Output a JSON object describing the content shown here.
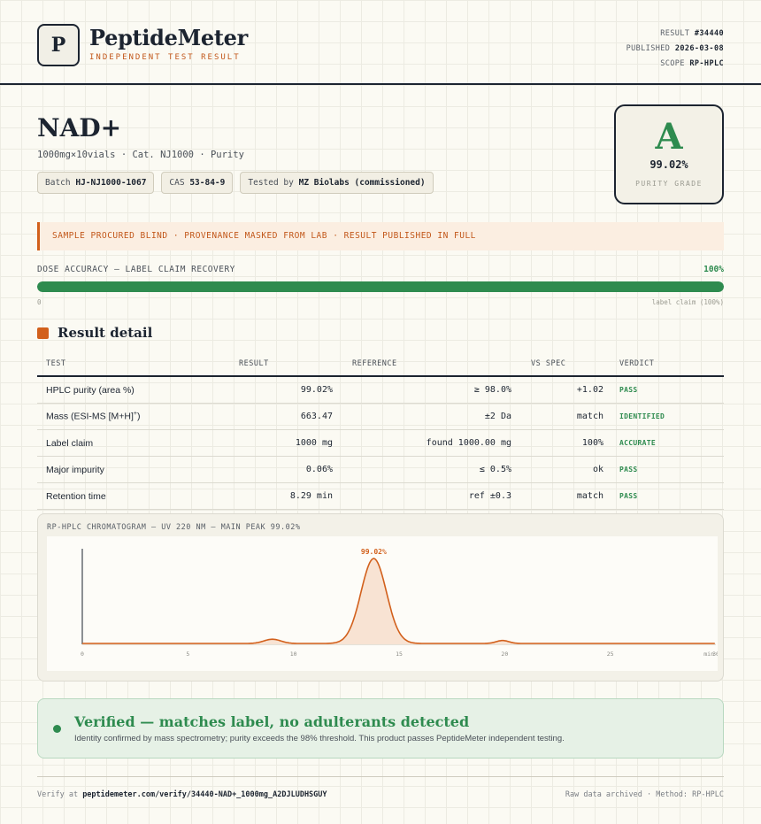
{
  "brand": {
    "logo_letter": "P",
    "name": "PeptideMeter",
    "subtitle": "INDEPENDENT TEST RESULT"
  },
  "meta": {
    "result_label": "RESULT",
    "result_value": "#34440",
    "published_label": "PUBLISHED",
    "published_value": "2026-03-08",
    "scope_label": "SCOPE",
    "scope_value": "RP-HPLC"
  },
  "product": {
    "name": "NAD+",
    "line": "1000mg×10vials · Cat. NJ1000 · Purity",
    "tags": [
      {
        "label": "Batch",
        "value": "HJ-NJ1000-1067"
      },
      {
        "label": "CAS",
        "value": "53-84-9"
      },
      {
        "label": "Tested by",
        "value": "MZ Biolabs (commissioned)"
      }
    ]
  },
  "grade": {
    "letter": "A",
    "value": "99.02%",
    "label": "PURITY GRADE"
  },
  "banner": "SAMPLE PROCURED BLIND · PROVENANCE MASKED FROM LAB · RESULT PUBLISHED IN FULL",
  "dose": {
    "label": "DOSE ACCURACY — LABEL CLAIM RECOVERY",
    "percent_text": "100%",
    "fill_percent": 100,
    "zero": "0",
    "claim": "label claim (100%)"
  },
  "section_title": "Result detail",
  "table": {
    "headers": [
      "TEST",
      "RESULT",
      "REFERENCE",
      "VS SPEC",
      "VERDICT"
    ],
    "rows": [
      {
        "test": "HPLC purity (area %)",
        "sup": "",
        "result": "99.02%",
        "reference": "≥ 98.0%",
        "vs": "+1.02",
        "verdict": "PASS"
      },
      {
        "test": "Mass (ESI-MS [M+H]",
        "sup": "+",
        "test_tail": ")",
        "result": "663.47",
        "reference": "±2 Da",
        "vs": "match",
        "verdict": "IDENTIFIED"
      },
      {
        "test": "Label claim",
        "sup": "",
        "result": "1000 mg",
        "reference": "found 1000.00 mg",
        "vs": "100%",
        "verdict": "ACCURATE"
      },
      {
        "test": "Major impurity",
        "sup": "",
        "result": "0.06%",
        "reference": "≤ 0.5%",
        "vs": "ok",
        "verdict": "PASS"
      },
      {
        "test": "Retention time",
        "sup": "",
        "result": "8.29 min",
        "reference": "ref ±0.3",
        "vs": "match",
        "verdict": "PASS"
      }
    ]
  },
  "chart_data": {
    "type": "line",
    "title": "RP-HPLC CHROMATOGRAM — UV 220 NM — MAIN PEAK 99.02%",
    "xlabel": "min",
    "ylabel": "",
    "xlim": [
      0,
      30
    ],
    "x_ticks": [
      "0",
      "5",
      "10",
      "15",
      "20",
      "25",
      "30"
    ],
    "peaks": [
      {
        "center": 9.0,
        "height": 0.05,
        "width": 0.4
      },
      {
        "center": 13.8,
        "height": 1.0,
        "width": 0.6,
        "label": "99.02%"
      },
      {
        "center": 19.9,
        "height": 0.035,
        "width": 0.3
      }
    ],
    "baseline": 0.01,
    "colors": {
      "line": "#d2601c",
      "fill": "#f8e3d3"
    }
  },
  "verified": {
    "title": "Verified — matches label, no adulterants detected",
    "subtitle": "Identity confirmed by mass spectrometry; purity exceeds the 98% threshold. This product passes PeptideMeter independent testing."
  },
  "footer": {
    "verify_label": "Verify at",
    "verify_url": "peptidemeter.com/verify/34440-NAD+_1000mg_A2DJLUDHSGUY",
    "right": "Raw data archived · Method: RP-HPLC"
  },
  "colors": {
    "accent_orange": "#d2601c",
    "pass_green": "#2e8b4f",
    "ink": "#1c2430"
  }
}
